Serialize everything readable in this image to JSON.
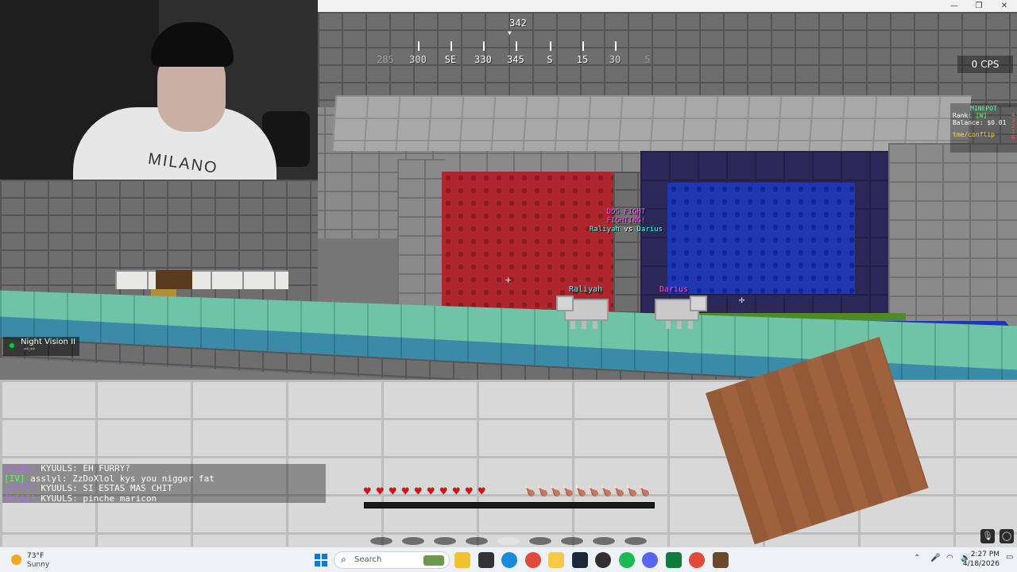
{
  "window": {
    "minimize_glyph": "—",
    "maximize_glyph": "❐",
    "close_glyph": "✕"
  },
  "compass": {
    "heading": "342",
    "labels": [
      "285",
      "300",
      "SE",
      "330",
      "345",
      "S",
      "15",
      "30",
      "5"
    ]
  },
  "cps": "0 CPS",
  "scoreboard": {
    "title": "MINEPOT",
    "rank_label": "Rank:",
    "rank_value": "[W]",
    "balance_label": "Balance:",
    "balance_value": "$0.01",
    "link": "tme/conflip",
    "side_numbers": "43210"
  },
  "fight_banner": {
    "line1": "DOG FIGHT",
    "line2": "FIGHTING!",
    "left_name": "Raliyah",
    "vs": "vs",
    "right_name": "Darius"
  },
  "nametags": {
    "left": "Raliyah",
    "right": "Darius"
  },
  "effect": {
    "name": "Night Vision II",
    "time": "**:**",
    "icon": "night-vision-icon"
  },
  "chat": [
    {
      "rank": "[VIII]",
      "rank_color": "#b366ff",
      "user": "KYUULS:",
      "message": "EH FURRY?"
    },
    {
      "rank": "[IV]",
      "rank_color": "#57ff57",
      "user": "asslyl:",
      "message": "ZzDoXlol kys you nigger fat"
    },
    {
      "rank": "[VIII]",
      "rank_color": "#b366ff",
      "user": "KYUULS:",
      "message": "SI ESTAS MAS CHIT"
    },
    {
      "rank": "[VIII]",
      "rank_color": "#b366ff",
      "user": "KYUULS:",
      "message": "pinche maricon"
    }
  ],
  "hud": {
    "hearts": 10,
    "hunger": 10,
    "hotbar_slots": 9,
    "selected_slot": 4,
    "xp_progress": 0
  },
  "webcam": {
    "shirt_text": "MILANO"
  },
  "taskbar": {
    "weather_temp": "73°F",
    "weather_cond": "Sunny",
    "search_placeholder": "Search",
    "time": "2:27 PM",
    "date": "4/18/2026",
    "apps": [
      {
        "name": "file-explorer-icon",
        "color": "#f2c230"
      },
      {
        "name": "task-view-icon",
        "color": "#333333"
      },
      {
        "name": "edge-icon",
        "color": "#1c8ad8"
      },
      {
        "name": "chrome-icon",
        "color": "#e04a3a"
      },
      {
        "name": "folder-icon",
        "color": "#f7c948"
      },
      {
        "name": "steam-icon",
        "color": "#1b2838"
      },
      {
        "name": "obs-icon",
        "color": "#302e31"
      },
      {
        "name": "spotify-icon",
        "color": "#1db954"
      },
      {
        "name": "discord-icon",
        "color": "#5865f2"
      },
      {
        "name": "app-green-icon",
        "color": "#0f7b3c"
      },
      {
        "name": "chrome-icon-2",
        "color": "#e04a3a"
      },
      {
        "name": "minecraft-icon",
        "color": "#6b4a2b"
      }
    ]
  },
  "colors": {
    "heart": "#d2121b",
    "hunger": "#c5781c",
    "accent": "#0a7cd8"
  }
}
